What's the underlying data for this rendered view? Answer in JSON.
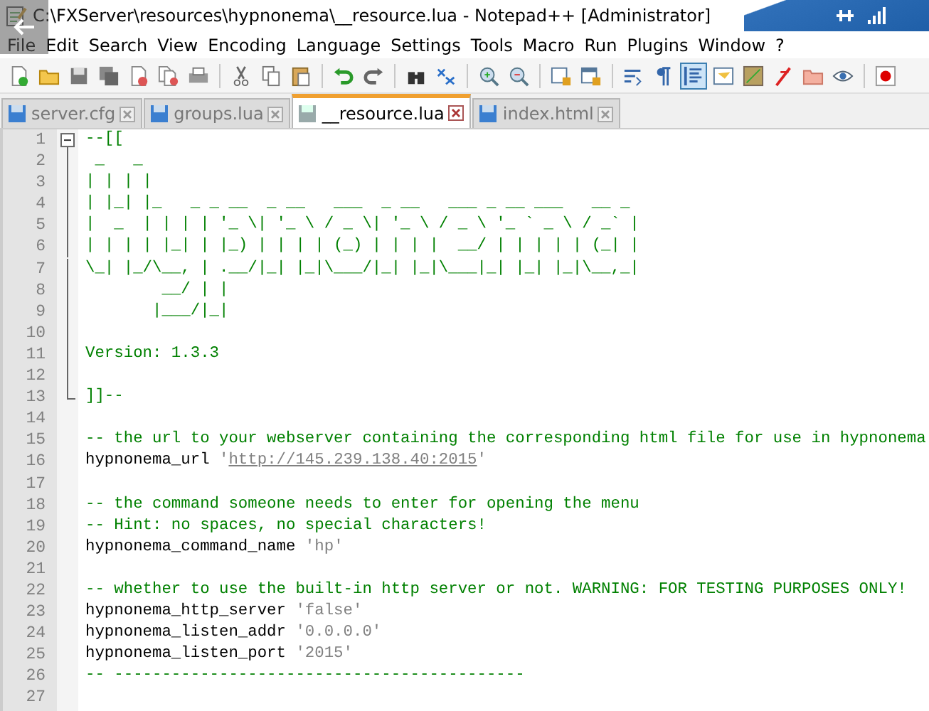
{
  "window": {
    "title": "C:\\FXServer\\resources\\hypnonema\\__resource.lua - Notepad++ [Administrator]"
  },
  "menu": [
    "File",
    "Edit",
    "Search",
    "View",
    "Encoding",
    "Language",
    "Settings",
    "Tools",
    "Macro",
    "Run",
    "Plugins",
    "Window",
    "?"
  ],
  "toolbar": {
    "buttons": [
      {
        "pressed": false
      },
      {
        "pressed": false
      },
      {
        "pressed": false
      },
      {
        "pressed": false
      },
      {
        "pressed": false
      },
      {
        "pressed": false
      },
      {
        "pressed": false
      },
      {
        "pressed": false
      },
      {
        "pressed": false
      },
      {
        "pressed": false
      },
      {
        "pressed": false
      },
      {
        "pressed": false
      },
      {
        "pressed": false
      },
      {
        "pressed": false
      },
      {
        "pressed": false
      },
      {
        "pressed": false
      },
      {
        "pressed": false
      },
      {
        "pressed": false
      },
      {
        "pressed": false
      },
      {
        "pressed": false
      },
      {
        "pressed": true
      },
      {
        "pressed": false
      },
      {
        "pressed": false
      },
      {
        "pressed": false
      },
      {
        "pressed": false
      },
      {
        "pressed": false
      },
      {
        "pressed": false
      }
    ]
  },
  "tabs": [
    {
      "label": "server.cfg",
      "selected": false
    },
    {
      "label": "groups.lua",
      "selected": false
    },
    {
      "label": "__resource.lua",
      "selected": true
    },
    {
      "label": "index.html",
      "selected": false
    }
  ],
  "editor": {
    "lines": [
      {
        "number": "1",
        "kind": "fold-start",
        "segments": [
          {
            "kind": "comment",
            "text": "--[["
          }
        ]
      },
      {
        "number": "2",
        "kind": "fold-body",
        "segments": [
          {
            "kind": "comment",
            "text": " _   _"
          }
        ]
      },
      {
        "number": "3",
        "kind": "fold-body",
        "segments": [
          {
            "kind": "comment",
            "text": "| | | |"
          }
        ]
      },
      {
        "number": "4",
        "kind": "fold-body",
        "segments": [
          {
            "kind": "comment",
            "text": "| |_| |_   _ _ __  _ __   ___  _ __   ___ _ __ ___   __ _"
          }
        ]
      },
      {
        "number": "5",
        "kind": "fold-body",
        "segments": [
          {
            "kind": "comment",
            "text": "|  _  | | | | '_ \\| '_ \\ / _ \\| '_ \\ / _ \\ '_ ` _ \\ / _` |"
          }
        ]
      },
      {
        "number": "6",
        "kind": "fold-body",
        "segments": [
          {
            "kind": "comment",
            "text": "| | | | |_| | |_) | | | | (_) | | | |  __/ | | | | | (_| |"
          }
        ]
      },
      {
        "number": "7",
        "kind": "fold-body",
        "segments": [
          {
            "kind": "comment",
            "text": "\\_| |_/\\__, | .__/|_| |_|\\___/|_| |_|\\___|_| |_| |_|\\__,_|"
          }
        ]
      },
      {
        "number": "8",
        "kind": "fold-body",
        "segments": [
          {
            "kind": "comment",
            "text": "        __/ | |"
          }
        ]
      },
      {
        "number": "9",
        "kind": "fold-body",
        "segments": [
          {
            "kind": "comment",
            "text": "       |___/|_|"
          }
        ]
      },
      {
        "number": "10",
        "kind": "fold-body"
      },
      {
        "number": "11",
        "kind": "fold-body",
        "segments": [
          {
            "kind": "comment",
            "text": "Version: 1.3.3"
          }
        ]
      },
      {
        "number": "12",
        "kind": "fold-body"
      },
      {
        "number": "13",
        "kind": "fold-end",
        "segments": [
          {
            "kind": "comment",
            "text": "]]--"
          }
        ]
      },
      {
        "number": "14",
        "kind": "normal"
      },
      {
        "number": "15",
        "kind": "normal",
        "segments": [
          {
            "kind": "comment",
            "text": "-- the url to your webserver containing the corresponding html file for use in hypnonema"
          }
        ]
      },
      {
        "number": "16",
        "kind": "normal",
        "segments": [
          {
            "kind": "plain",
            "text": "hypnonema_url "
          },
          {
            "kind": "string",
            "text": "'"
          },
          {
            "kind": "url",
            "text": "http://145.239.138.40:2015"
          },
          {
            "kind": "string",
            "text": "'"
          }
        ]
      },
      {
        "number": "17",
        "kind": "normal"
      },
      {
        "number": "18",
        "kind": "normal",
        "segments": [
          {
            "kind": "comment",
            "text": "-- the command someone needs to enter for opening the menu"
          }
        ]
      },
      {
        "number": "19",
        "kind": "normal",
        "segments": [
          {
            "kind": "comment",
            "text": "-- Hint: no spaces, no special characters!"
          }
        ]
      },
      {
        "number": "20",
        "kind": "normal",
        "segments": [
          {
            "kind": "plain",
            "text": "hypnonema_command_name "
          },
          {
            "kind": "string",
            "text": "'hp'"
          }
        ]
      },
      {
        "number": "21",
        "kind": "normal"
      },
      {
        "number": "22",
        "kind": "normal",
        "segments": [
          {
            "kind": "comment",
            "text": "-- whether to use the built-in http server or not. WARNING: FOR TESTING PURPOSES ONLY!"
          }
        ]
      },
      {
        "number": "23",
        "kind": "normal",
        "segments": [
          {
            "kind": "plain",
            "text": "hypnonema_http_server "
          },
          {
            "kind": "string",
            "text": "'false'"
          }
        ]
      },
      {
        "number": "24",
        "kind": "normal",
        "segments": [
          {
            "kind": "plain",
            "text": "hypnonema_listen_addr "
          },
          {
            "kind": "string",
            "text": "'0.0.0.0'"
          }
        ]
      },
      {
        "number": "25",
        "kind": "normal",
        "segments": [
          {
            "kind": "plain",
            "text": "hypnonema_listen_port "
          },
          {
            "kind": "string",
            "text": "'2015'"
          }
        ]
      },
      {
        "number": "26",
        "kind": "normal",
        "segments": [
          {
            "kind": "comment",
            "text": "-- -------------------------------------------"
          }
        ]
      },
      {
        "number": "27",
        "kind": "normal"
      }
    ]
  }
}
